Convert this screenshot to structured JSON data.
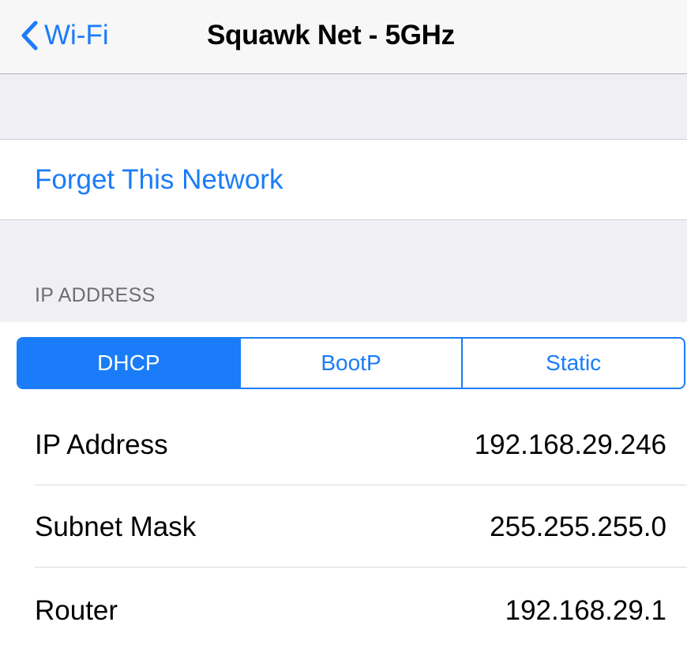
{
  "navbar": {
    "back_label": "Wi-Fi",
    "title": "Squawk Net - 5GHz",
    "back_icon": "chevron-left-icon"
  },
  "actions": {
    "forget_label": "Forget This Network"
  },
  "ip_section": {
    "header": "IP ADDRESS",
    "modes": [
      {
        "label": "DHCP",
        "selected": true
      },
      {
        "label": "BootP",
        "selected": false
      },
      {
        "label": "Static",
        "selected": false
      }
    ]
  },
  "details": [
    {
      "label": "IP Address",
      "value": "192.168.29.246"
    },
    {
      "label": "Subnet Mask",
      "value": "255.255.255.0"
    },
    {
      "label": "Router",
      "value": "192.168.29.1"
    }
  ],
  "colors": {
    "accent": "#1a7cf8",
    "grouped_background": "#efeff4",
    "navbar_background": "#f7f7f7",
    "section_header_text": "#6d6d72"
  }
}
